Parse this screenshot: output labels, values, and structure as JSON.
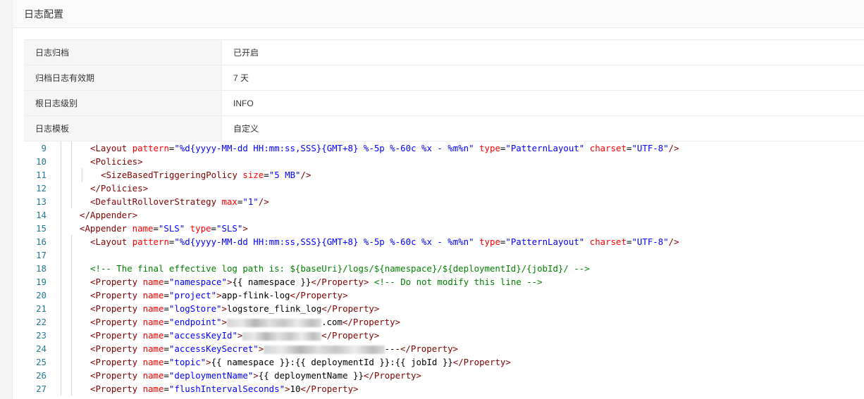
{
  "panel": {
    "title": "日志配置"
  },
  "info_rows": [
    {
      "label": "日志归档",
      "value": "已开启"
    },
    {
      "label": "归档日志有效期",
      "value": "7 天"
    },
    {
      "label": "根日志级别",
      "value": "INFO"
    },
    {
      "label": "日志模板",
      "value": "自定义"
    }
  ],
  "code_lines": [
    {
      "num": "9",
      "indent": 2,
      "tokens": [
        [
          "tag",
          "<Layout "
        ],
        [
          "attr",
          "pattern"
        ],
        [
          "txt",
          "="
        ],
        [
          "val",
          "\"%d{yyyy-MM-dd HH:mm:ss,SSS}{GMT+8} %-5p %-60c %x - %m%n\""
        ],
        [
          "txt",
          " "
        ],
        [
          "attr",
          "type"
        ],
        [
          "txt",
          "="
        ],
        [
          "val",
          "\"PatternLayout\""
        ],
        [
          "txt",
          " "
        ],
        [
          "attr",
          "charset"
        ],
        [
          "txt",
          "="
        ],
        [
          "val",
          "\"UTF-8\""
        ],
        [
          "tag",
          "/>"
        ]
      ]
    },
    {
      "num": "10",
      "indent": 2,
      "tokens": [
        [
          "tag",
          "<Policies>"
        ]
      ]
    },
    {
      "num": "11",
      "indent": 3,
      "tokens": [
        [
          "tag",
          "<SizeBasedTriggeringPolicy "
        ],
        [
          "attr",
          "size"
        ],
        [
          "txt",
          "="
        ],
        [
          "val",
          "\"5 MB\""
        ],
        [
          "tag",
          "/>"
        ]
      ]
    },
    {
      "num": "12",
      "indent": 2,
      "tokens": [
        [
          "tag",
          "</Policies>"
        ]
      ]
    },
    {
      "num": "13",
      "indent": 2,
      "tokens": [
        [
          "tag",
          "<DefaultRolloverStrategy "
        ],
        [
          "attr",
          "max"
        ],
        [
          "txt",
          "="
        ],
        [
          "val",
          "\"1\""
        ],
        [
          "tag",
          "/>"
        ]
      ]
    },
    {
      "num": "14",
      "indent": 1,
      "tokens": [
        [
          "tag",
          "</Appender>"
        ]
      ]
    },
    {
      "num": "15",
      "indent": 1,
      "tokens": [
        [
          "tag",
          "<Appender "
        ],
        [
          "attr",
          "name"
        ],
        [
          "txt",
          "="
        ],
        [
          "val",
          "\"SLS\""
        ],
        [
          "txt",
          " "
        ],
        [
          "attr",
          "type"
        ],
        [
          "txt",
          "="
        ],
        [
          "val",
          "\"SLS\""
        ],
        [
          "tag",
          ">"
        ]
      ]
    },
    {
      "num": "16",
      "indent": 2,
      "tokens": [
        [
          "tag",
          "<Layout "
        ],
        [
          "attr",
          "pattern"
        ],
        [
          "txt",
          "="
        ],
        [
          "val",
          "\"%d{yyyy-MM-dd HH:mm:ss,SSS}{GMT+8} %-5p %-60c %x - %m%n\""
        ],
        [
          "txt",
          " "
        ],
        [
          "attr",
          "type"
        ],
        [
          "txt",
          "="
        ],
        [
          "val",
          "\"PatternLayout\""
        ],
        [
          "txt",
          " "
        ],
        [
          "attr",
          "charset"
        ],
        [
          "txt",
          "="
        ],
        [
          "val",
          "\"UTF-8\""
        ],
        [
          "tag",
          "/>"
        ]
      ]
    },
    {
      "num": "17",
      "indent": 2,
      "tokens": []
    },
    {
      "num": "18",
      "indent": 2,
      "tokens": [
        [
          "cmt",
          "<!-- The final effective log path is: ${baseUri}/logs/${namespace}/${deploymentId}/{jobId}/ -->"
        ]
      ]
    },
    {
      "num": "19",
      "indent": 2,
      "tokens": [
        [
          "tag",
          "<Property "
        ],
        [
          "attr",
          "name"
        ],
        [
          "txt",
          "="
        ],
        [
          "val",
          "\"namespace\""
        ],
        [
          "tag",
          ">"
        ],
        [
          "txt",
          "{{ namespace }}"
        ],
        [
          "tag",
          "</Property>"
        ],
        [
          "txt",
          " "
        ],
        [
          "cmt",
          "<!-- Do not modify this line -->"
        ]
      ]
    },
    {
      "num": "20",
      "indent": 2,
      "tokens": [
        [
          "tag",
          "<Property "
        ],
        [
          "attr",
          "name"
        ],
        [
          "txt",
          "="
        ],
        [
          "val",
          "\"project\""
        ],
        [
          "tag",
          ">"
        ],
        [
          "txt",
          "app-flink-log"
        ],
        [
          "tag",
          "</Property>"
        ]
      ]
    },
    {
      "num": "21",
      "indent": 2,
      "tokens": [
        [
          "tag",
          "<Property "
        ],
        [
          "attr",
          "name"
        ],
        [
          "txt",
          "="
        ],
        [
          "val",
          "\"logStore\""
        ],
        [
          "tag",
          ">"
        ],
        [
          "txt",
          "logstore_flink_log"
        ],
        [
          "tag",
          "</Property>"
        ]
      ]
    },
    {
      "num": "22",
      "indent": 2,
      "tokens": [
        [
          "tag",
          "<Property "
        ],
        [
          "attr",
          "name"
        ],
        [
          "txt",
          "="
        ],
        [
          "val",
          "\"endpoint\""
        ],
        [
          "tag",
          ">"
        ],
        [
          "blur",
          "18"
        ],
        [
          "txt",
          ".com"
        ],
        [
          "tag",
          "</Property>"
        ]
      ]
    },
    {
      "num": "23",
      "indent": 2,
      "tokens": [
        [
          "tag",
          "<Property "
        ],
        [
          "attr",
          "name"
        ],
        [
          "txt",
          "="
        ],
        [
          "val",
          "\"accessKeyId\""
        ],
        [
          "tag",
          ">"
        ],
        [
          "blur",
          "15"
        ],
        [
          "tag",
          "</Property>"
        ]
      ]
    },
    {
      "num": "24",
      "indent": 2,
      "tokens": [
        [
          "tag",
          "<Property "
        ],
        [
          "attr",
          "name"
        ],
        [
          "txt",
          "="
        ],
        [
          "val",
          "\"accessKeySecret\""
        ],
        [
          "tag",
          ">"
        ],
        [
          "blur",
          "23"
        ],
        [
          "txt",
          "---"
        ],
        [
          "tag",
          "</Property>"
        ]
      ]
    },
    {
      "num": "25",
      "indent": 2,
      "tokens": [
        [
          "tag",
          "<Property "
        ],
        [
          "attr",
          "name"
        ],
        [
          "txt",
          "="
        ],
        [
          "val",
          "\"topic\""
        ],
        [
          "tag",
          ">"
        ],
        [
          "txt",
          "{{ namespace }}:{{ deploymentId }}:{{ jobId }}"
        ],
        [
          "tag",
          "</Property>"
        ]
      ]
    },
    {
      "num": "26",
      "indent": 2,
      "tokens": [
        [
          "tag",
          "<Property "
        ],
        [
          "attr",
          "name"
        ],
        [
          "txt",
          "="
        ],
        [
          "val",
          "\"deploymentName\""
        ],
        [
          "tag",
          ">"
        ],
        [
          "txt",
          "{{ deploymentName }}"
        ],
        [
          "tag",
          "</Property>"
        ]
      ]
    },
    {
      "num": "27",
      "indent": 2,
      "tokens": [
        [
          "tag",
          "<Property "
        ],
        [
          "attr",
          "name"
        ],
        [
          "txt",
          "="
        ],
        [
          "val",
          "\"flushIntervalSeconds\""
        ],
        [
          "tag",
          ">"
        ],
        [
          "txt",
          "10"
        ],
        [
          "tag",
          "</Property>"
        ]
      ]
    }
  ]
}
